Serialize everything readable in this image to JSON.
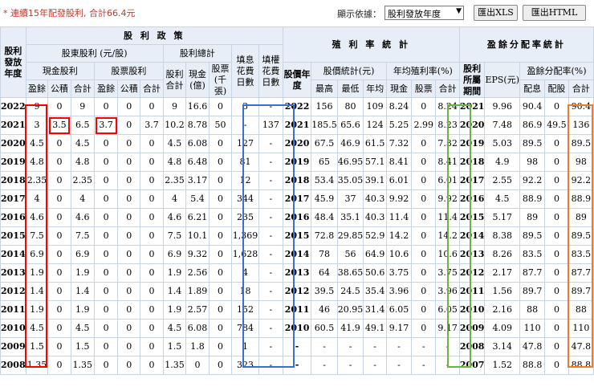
{
  "note": "* 連續15年配發股利, 合計66.4元",
  "toolbar": {
    "sort_label": "顯示依據：",
    "sort_value": "股利發放年度",
    "xls_button": "匯出XLS",
    "html_button": "匯出HTML"
  },
  "headers": {
    "dividend_policy": "股 利 政 策",
    "yield_stats": "殖 利 率 統 計",
    "payout_stats": "盈餘分配率統計",
    "year": "股利發放年度",
    "shareholder_div": "股東股利 (元/股)",
    "div_total": "股利總計",
    "fill_div_days": "填息花費日數",
    "fill_right_days": "填權花費日數",
    "cash_div": "現金股利",
    "stock_div": "股票股利",
    "earnings": "盈餘",
    "reserve": "公積",
    "sum": "合計",
    "div_sum": "股利合計",
    "cash_yi": "現金(億)",
    "stock_k": "股票(千張)",
    "price_year": "股價年度",
    "price_stats": "股價統計(元)",
    "avg_yield": "年均殖利率(%)",
    "high": "最高",
    "low": "最低",
    "avg": "年均",
    "cash": "現金",
    "stock": "股票",
    "belong_period": "股利所屬期間",
    "eps": "EPS(元)",
    "payout_ratio": "盈餘分配率(%)",
    "allot": "配息",
    "share_allot": "配股"
  },
  "rows": [
    [
      "2022",
      "9",
      "0",
      "9",
      "0",
      "0",
      "0",
      "9",
      "16.6",
      "0",
      "3",
      "-",
      "2022",
      "156",
      "80",
      "109",
      "8.24",
      "0",
      "8.24",
      "2021",
      "9.96",
      "90.4",
      "0",
      "90.4"
    ],
    [
      "2021",
      "3",
      "3.5",
      "6.5",
      "3.7",
      "0",
      "3.7",
      "10.2",
      "8.78",
      "50",
      "-",
      "137",
      "2021",
      "185.5",
      "65.6",
      "124",
      "5.25",
      "2.99",
      "8.23",
      "2020",
      "7.48",
      "86.9",
      "49.5",
      "136"
    ],
    [
      "2020",
      "4.5",
      "0",
      "4.5",
      "0",
      "0",
      "0",
      "4.5",
      "6.08",
      "0",
      "127",
      "-",
      "2020",
      "67.5",
      "46.9",
      "61.5",
      "7.32",
      "0",
      "7.32",
      "2019",
      "5.03",
      "89.5",
      "0",
      "89.5"
    ],
    [
      "2019",
      "4.8",
      "0",
      "4.8",
      "0",
      "0",
      "0",
      "4.8",
      "6.48",
      "0",
      "81",
      "-",
      "2019",
      "65",
      "46.95",
      "57.1",
      "8.41",
      "0",
      "8.41",
      "2018",
      "4.9",
      "98",
      "0",
      "98"
    ],
    [
      "2018",
      "2.35",
      "0",
      "2.35",
      "0",
      "0",
      "0",
      "2.35",
      "3.17",
      "0",
      "12",
      "-",
      "2018",
      "53.4",
      "35.05",
      "39.1",
      "6.01",
      "0",
      "6.01",
      "2017",
      "2.55",
      "92.2",
      "0",
      "92.2"
    ],
    [
      "2017",
      "4",
      "0",
      "4",
      "0",
      "0",
      "0",
      "4",
      "5.4",
      "0",
      "344",
      "-",
      "2017",
      "45.9",
      "37",
      "40.3",
      "9.92",
      "0",
      "9.92",
      "2016",
      "4.5",
      "88.9",
      "0",
      "88.9"
    ],
    [
      "2016",
      "4.6",
      "0",
      "4.6",
      "0",
      "0",
      "0",
      "4.6",
      "6.21",
      "0",
      "235",
      "-",
      "2016",
      "48.4",
      "35.1",
      "40.3",
      "11.4",
      "0",
      "11.4",
      "2015",
      "5.17",
      "89",
      "0",
      "89"
    ],
    [
      "2015",
      "7.5",
      "0",
      "7.5",
      "0",
      "0",
      "0",
      "7.5",
      "10.1",
      "0",
      "1,369",
      "-",
      "2015",
      "72.8",
      "29.85",
      "52.9",
      "14.2",
      "0",
      "14.2",
      "2014",
      "8.38",
      "89.5",
      "0",
      "89.5"
    ],
    [
      "2014",
      "6.9",
      "0",
      "6.9",
      "0",
      "0",
      "0",
      "6.9",
      "9.32",
      "0",
      "1,628",
      "-",
      "2014",
      "78",
      "56",
      "64.9",
      "10.6",
      "0",
      "10.6",
      "2013",
      "8.26",
      "83.5",
      "0",
      "83.5"
    ],
    [
      "2013",
      "1.9",
      "0",
      "1.9",
      "0",
      "0",
      "0",
      "1.9",
      "2.56",
      "0",
      "4",
      "-",
      "2013",
      "64",
      "38.65",
      "50.6",
      "3.75",
      "0",
      "3.75",
      "2012",
      "2.17",
      "87.7",
      "0",
      "87.7"
    ],
    [
      "2012",
      "1.4",
      "0",
      "1.4",
      "0",
      "0",
      "0",
      "1.4",
      "1.89",
      "0",
      "18",
      "-",
      "2012",
      "39.5",
      "24.5",
      "35.4",
      "3.96",
      "0",
      "3.96",
      "2011",
      "1.56",
      "89.7",
      "0",
      "89.7"
    ],
    [
      "2011",
      "1.9",
      "0",
      "1.9",
      "0",
      "0",
      "0",
      "1.9",
      "2.57",
      "0",
      "152",
      "-",
      "2011",
      "46",
      "20.95",
      "31.4",
      "6.05",
      "0",
      "6.05",
      "2010",
      "2.16",
      "88",
      "0",
      "88"
    ],
    [
      "2010",
      "4.5",
      "0",
      "4.5",
      "0",
      "0",
      "0",
      "4.5",
      "6.08",
      "0",
      "784",
      "-",
      "2010",
      "60.5",
      "41.9",
      "49.1",
      "9.17",
      "0",
      "9.17",
      "2009",
      "4.09",
      "110",
      "0",
      "110"
    ],
    [
      "2009",
      "1.5",
      "0",
      "1.5",
      "0",
      "0",
      "0",
      "1.5",
      "1.8",
      "0",
      "1",
      "-",
      "-",
      "-",
      "-",
      "-",
      "-",
      "-",
      "-",
      "2008",
      "3.14",
      "47.8",
      "0",
      "47.8"
    ],
    [
      "2008",
      "1.35",
      "0",
      "1.35",
      "0",
      "0",
      "0",
      "1.35",
      "0",
      "0",
      "323",
      "-",
      "-",
      "-",
      "-",
      "-",
      "-",
      "-",
      "-",
      "2007",
      "1.52",
      "88.8",
      "0",
      "88.8"
    ]
  ],
  "highlights": {
    "red": "#ff0000",
    "blue": "#3a6fd1",
    "green": "#69b540",
    "orange": "#f07a2c"
  }
}
